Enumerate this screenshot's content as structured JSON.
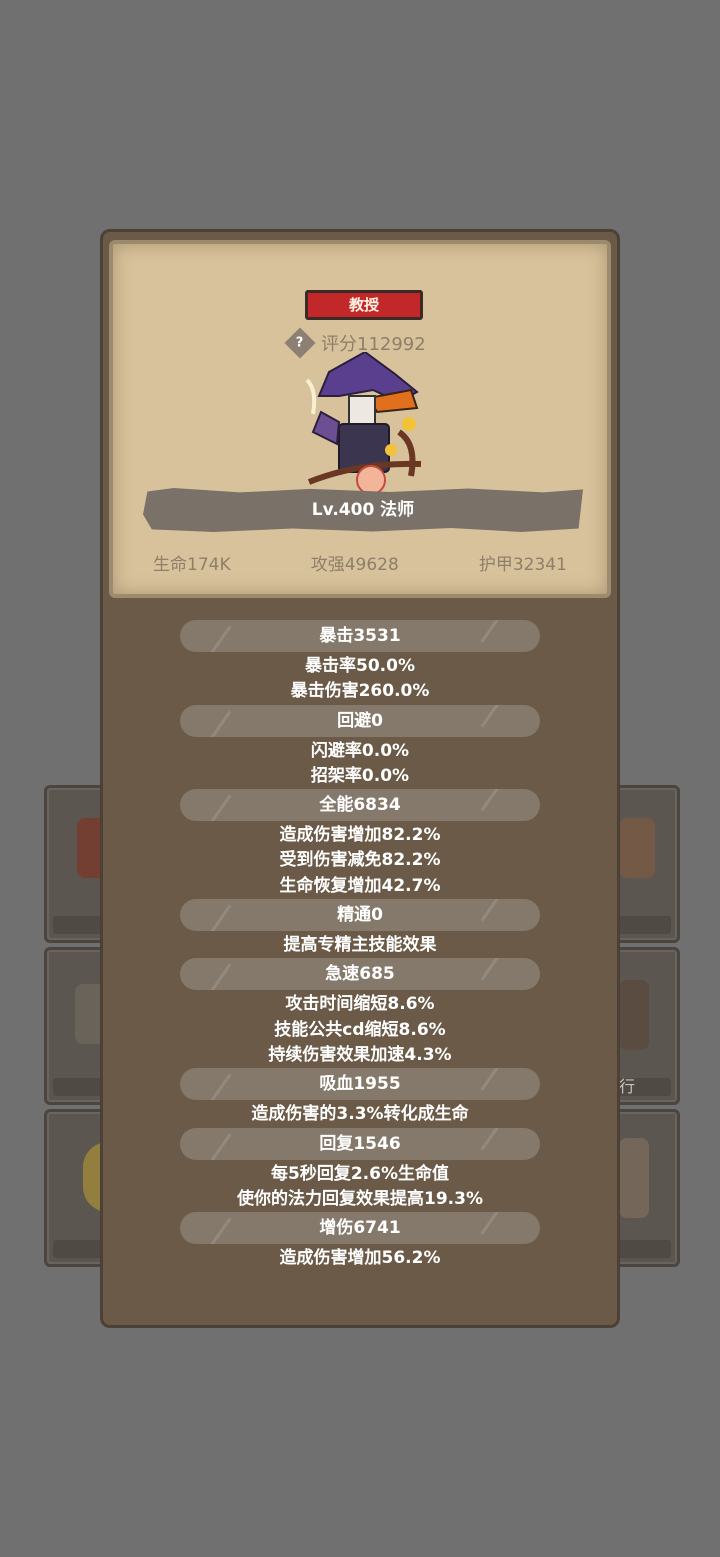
{
  "background_slots": {
    "right_label": "行"
  },
  "card": {
    "class_button": "教授",
    "score": "评分112992",
    "level": "Lv.400 法师",
    "stats": [
      {
        "label": "生命174K"
      },
      {
        "label": "攻强49628"
      },
      {
        "label": "护甲32341"
      }
    ]
  },
  "attributes": [
    {
      "header": "暴击3531",
      "lines": [
        "暴击率50.0%",
        "暴击伤害260.0%"
      ]
    },
    {
      "header": "回避0",
      "lines": [
        "闪避率0.0%",
        "招架率0.0%"
      ]
    },
    {
      "header": "全能6834",
      "lines": [
        "造成伤害增加82.2%",
        "受到伤害减免82.2%",
        "生命恢复增加42.7%"
      ]
    },
    {
      "header": "精通0",
      "lines": [
        "提高专精主技能效果"
      ]
    },
    {
      "header": "急速685",
      "lines": [
        "攻击时间缩短8.6%",
        "技能公共cd缩短8.6%",
        "持续伤害效果加速4.3%"
      ]
    },
    {
      "header": "吸血1955",
      "lines": [
        "造成伤害的3.3%转化成生命"
      ]
    },
    {
      "header": "回复1546",
      "lines": [
        "每5秒回复2.6%生命值",
        "使你的法力回复效果提高19.3%"
      ]
    },
    {
      "header": "增伤6741",
      "lines": [
        "造成伤害增加56.2%"
      ]
    }
  ],
  "colors": {
    "background": "#707070",
    "panel": "#6a5a47",
    "parchment": "#d7c29c",
    "class_button": "#c2282a"
  }
}
